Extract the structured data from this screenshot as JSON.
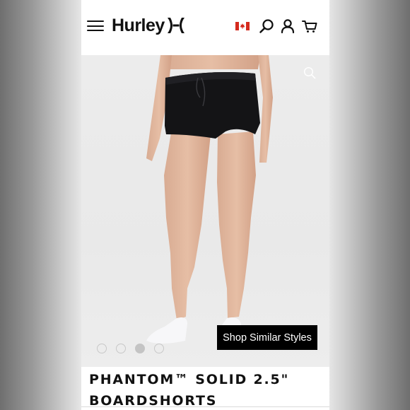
{
  "header": {
    "brand": "Hurley",
    "menu_icon": "hamburger-menu-icon",
    "locale_icon": "canada-flag-icon",
    "search_icon": "search-icon",
    "account_icon": "user-icon",
    "cart_icon": "cart-icon"
  },
  "gallery": {
    "zoom_icon": "zoom-icon",
    "dots": 4,
    "active_dot": 3,
    "shop_similar_label": "Shop Similar Styles"
  },
  "product": {
    "title": "PHANTOM™ SOLID 2.5\" BOARDSHORTS"
  },
  "colors": {
    "accent": "#000000",
    "flag_red": "#d52b1e",
    "background": "#ffffff"
  }
}
